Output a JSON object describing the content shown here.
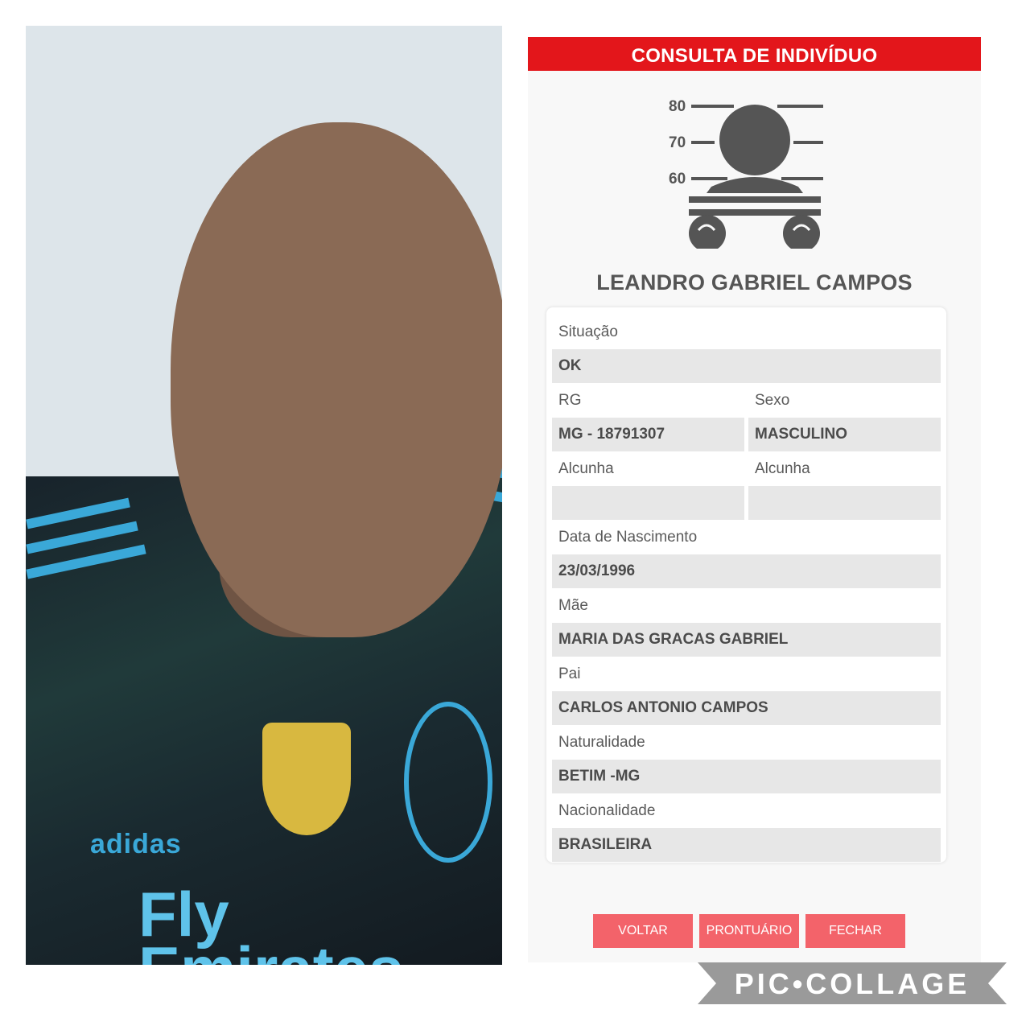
{
  "photo": {
    "brand_text": "adidas",
    "sponsor_text": "Fly Emirates"
  },
  "header": {
    "title": "CONSULTA DE INDIVÍDUO"
  },
  "mugshot": {
    "height_marks": [
      "80",
      "70",
      "60"
    ]
  },
  "person": {
    "name": "LEANDRO GABRIEL CAMPOS"
  },
  "fields": {
    "situacao_label": "Situação",
    "situacao_value": "OK",
    "rg_label": "RG",
    "rg_value": "MG - 18791307",
    "sexo_label": "Sexo",
    "sexo_value": "MASCULINO",
    "alcunha_label_1": "Alcunha",
    "alcunha_value_1": "",
    "alcunha_label_2": "Alcunha",
    "alcunha_value_2": "",
    "nascimento_label": "Data de Nascimento",
    "nascimento_value": "23/03/1996",
    "mae_label": "Mãe",
    "mae_value": "MARIA DAS GRACAS GABRIEL",
    "pai_label": "Pai",
    "pai_value": "CARLOS ANTONIO CAMPOS",
    "naturalidade_label": "Naturalidade",
    "naturalidade_value": "BETIM -MG",
    "nacionalidade_label": "Nacionalidade",
    "nacionalidade_value": "BRASILEIRA"
  },
  "buttons": {
    "voltar": "VOLTAR",
    "prontuario": "PRONTUÁRIO",
    "fechar": "FECHAR"
  },
  "watermark": {
    "text": "PIC•COLLAGE"
  },
  "colors": {
    "header_red": "#e3161b",
    "button_red": "#f3636a",
    "value_bg": "#e7e7e7"
  }
}
